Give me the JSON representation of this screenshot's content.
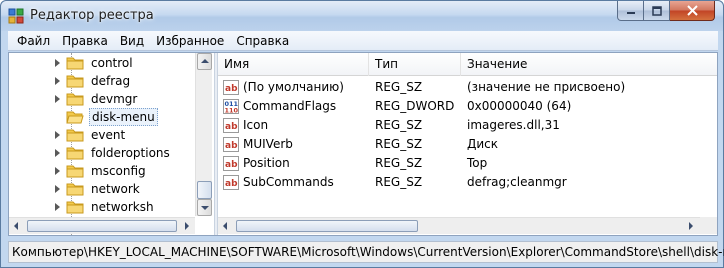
{
  "window": {
    "title": "Редактор реестра"
  },
  "menu": [
    "Файл",
    "Правка",
    "Вид",
    "Избранное",
    "Справка"
  ],
  "tree": {
    "items": [
      {
        "label": "control",
        "selected": false
      },
      {
        "label": "defrag",
        "selected": false
      },
      {
        "label": "devmgr",
        "selected": false
      },
      {
        "label": "disk-menu",
        "selected": true
      },
      {
        "label": "event",
        "selected": false
      },
      {
        "label": "folderoptions",
        "selected": false
      },
      {
        "label": "msconfig",
        "selected": false
      },
      {
        "label": "network",
        "selected": false
      },
      {
        "label": "networksh",
        "selected": false
      }
    ]
  },
  "list": {
    "columns": [
      "Имя",
      "Тип",
      "Значение"
    ],
    "rows": [
      {
        "icon": "string-value-icon",
        "name": "(По умолчанию)",
        "type": "REG_SZ",
        "value": "(значение не присвоено)"
      },
      {
        "icon": "binary-value-icon",
        "name": "CommandFlags",
        "type": "REG_DWORD",
        "value": "0x00000040 (64)"
      },
      {
        "icon": "string-value-icon",
        "name": "Icon",
        "type": "REG_SZ",
        "value": "imageres.dll,31"
      },
      {
        "icon": "string-value-icon",
        "name": "MUIVerb",
        "type": "REG_SZ",
        "value": "Диск"
      },
      {
        "icon": "string-value-icon",
        "name": "Position",
        "type": "REG_SZ",
        "value": "Top"
      },
      {
        "icon": "string-value-icon",
        "name": "SubCommands",
        "type": "REG_SZ",
        "value": "defrag;cleanmgr"
      }
    ]
  },
  "status": {
    "path": "Компьютер\\HKEY_LOCAL_MACHINE\\SOFTWARE\\Microsoft\\Windows\\CurrentVersion\\Explorer\\CommandStore\\shell\\disk-menu"
  },
  "colors": {
    "titlebar": "#c6d9f0",
    "close": "#c24426",
    "selection": "#eaf2fb",
    "reg_sz_icon": "#c0392b",
    "reg_dword_icon": "#1f4fa3"
  }
}
